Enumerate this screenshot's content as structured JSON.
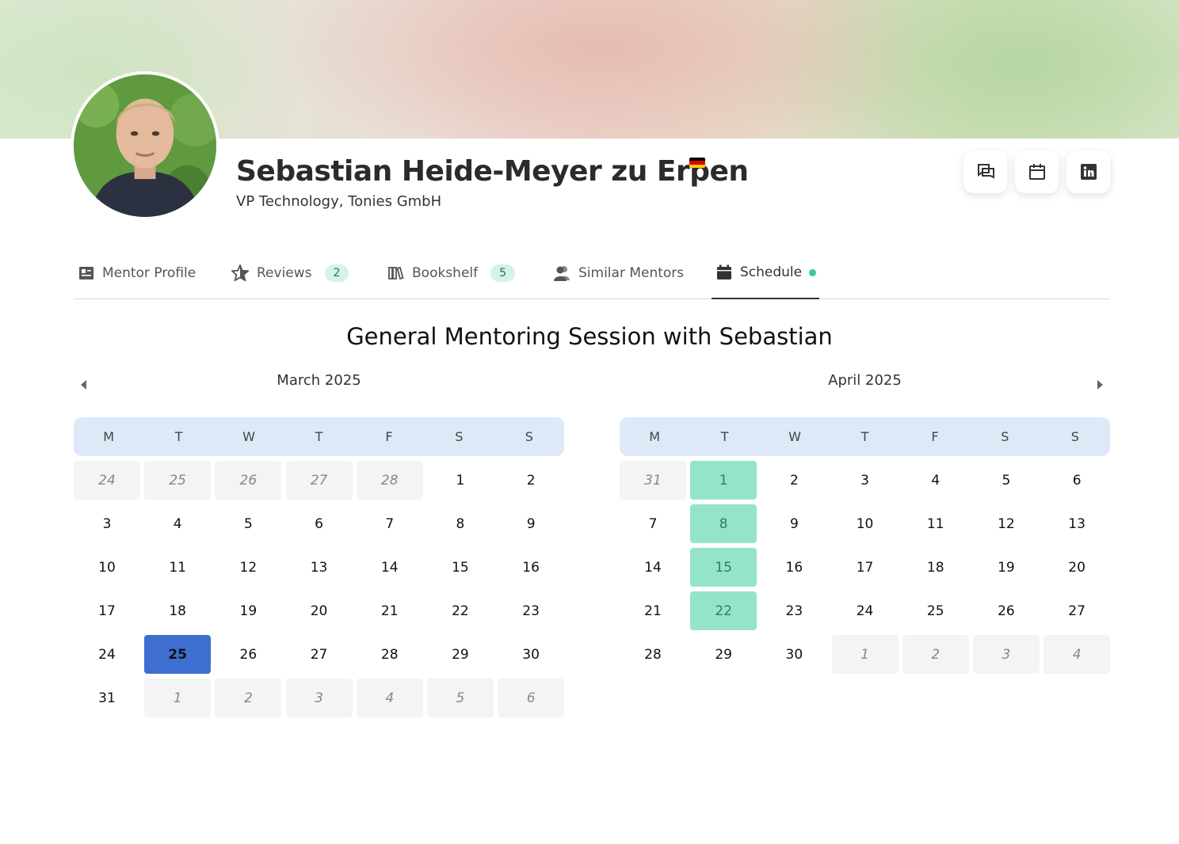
{
  "profile": {
    "name": "Sebastian Heide-Meyer zu Erpen",
    "subtitle": "VP Technology, Tonies GmbH",
    "flag_colors": [
      "#000000",
      "#dd0000",
      "#ffce00"
    ]
  },
  "actions": [
    {
      "icon": "chat-icon"
    },
    {
      "icon": "calendar-icon"
    },
    {
      "icon": "linkedin-icon"
    }
  ],
  "tabs": [
    {
      "label": "Mentor Profile",
      "icon": "profile-card-icon"
    },
    {
      "label": "Reviews",
      "icon": "star-icon",
      "badge": "2"
    },
    {
      "label": "Bookshelf",
      "icon": "books-icon",
      "badge": "5"
    },
    {
      "label": "Similar Mentors",
      "icon": "people-icon"
    },
    {
      "label": "Schedule",
      "icon": "calendar-icon",
      "active": true
    }
  ],
  "session_title": "General Mentoring Session with Sebastian",
  "calendars": [
    {
      "title": "March 2025",
      "weekdays": [
        "M",
        "T",
        "W",
        "T",
        "F",
        "S",
        "S"
      ],
      "days": [
        {
          "d": "24",
          "s": "out"
        },
        {
          "d": "25",
          "s": "out"
        },
        {
          "d": "26",
          "s": "out"
        },
        {
          "d": "27",
          "s": "out"
        },
        {
          "d": "28",
          "s": "out"
        },
        {
          "d": "1",
          "s": ""
        },
        {
          "d": "2",
          "s": ""
        },
        {
          "d": "3",
          "s": ""
        },
        {
          "d": "4",
          "s": ""
        },
        {
          "d": "5",
          "s": ""
        },
        {
          "d": "6",
          "s": ""
        },
        {
          "d": "7",
          "s": ""
        },
        {
          "d": "8",
          "s": ""
        },
        {
          "d": "9",
          "s": ""
        },
        {
          "d": "10",
          "s": ""
        },
        {
          "d": "11",
          "s": ""
        },
        {
          "d": "12",
          "s": ""
        },
        {
          "d": "13",
          "s": ""
        },
        {
          "d": "14",
          "s": ""
        },
        {
          "d": "15",
          "s": ""
        },
        {
          "d": "16",
          "s": ""
        },
        {
          "d": "17",
          "s": ""
        },
        {
          "d": "18",
          "s": ""
        },
        {
          "d": "19",
          "s": ""
        },
        {
          "d": "20",
          "s": ""
        },
        {
          "d": "21",
          "s": ""
        },
        {
          "d": "22",
          "s": ""
        },
        {
          "d": "23",
          "s": ""
        },
        {
          "d": "24",
          "s": ""
        },
        {
          "d": "25",
          "s": "today"
        },
        {
          "d": "26",
          "s": ""
        },
        {
          "d": "27",
          "s": ""
        },
        {
          "d": "28",
          "s": ""
        },
        {
          "d": "29",
          "s": ""
        },
        {
          "d": "30",
          "s": ""
        },
        {
          "d": "31",
          "s": ""
        },
        {
          "d": "1",
          "s": "out"
        },
        {
          "d": "2",
          "s": "out"
        },
        {
          "d": "3",
          "s": "out"
        },
        {
          "d": "4",
          "s": "out"
        },
        {
          "d": "5",
          "s": "out"
        },
        {
          "d": "6",
          "s": "out"
        }
      ]
    },
    {
      "title": "April 2025",
      "weekdays": [
        "M",
        "T",
        "W",
        "T",
        "F",
        "S",
        "S"
      ],
      "days": [
        {
          "d": "31",
          "s": "out"
        },
        {
          "d": "1",
          "s": "avail"
        },
        {
          "d": "2",
          "s": ""
        },
        {
          "d": "3",
          "s": ""
        },
        {
          "d": "4",
          "s": ""
        },
        {
          "d": "5",
          "s": ""
        },
        {
          "d": "6",
          "s": ""
        },
        {
          "d": "7",
          "s": ""
        },
        {
          "d": "8",
          "s": "avail"
        },
        {
          "d": "9",
          "s": ""
        },
        {
          "d": "10",
          "s": ""
        },
        {
          "d": "11",
          "s": ""
        },
        {
          "d": "12",
          "s": ""
        },
        {
          "d": "13",
          "s": ""
        },
        {
          "d": "14",
          "s": ""
        },
        {
          "d": "15",
          "s": "avail"
        },
        {
          "d": "16",
          "s": ""
        },
        {
          "d": "17",
          "s": ""
        },
        {
          "d": "18",
          "s": ""
        },
        {
          "d": "19",
          "s": ""
        },
        {
          "d": "20",
          "s": ""
        },
        {
          "d": "21",
          "s": ""
        },
        {
          "d": "22",
          "s": "avail"
        },
        {
          "d": "23",
          "s": ""
        },
        {
          "d": "24",
          "s": ""
        },
        {
          "d": "25",
          "s": ""
        },
        {
          "d": "26",
          "s": ""
        },
        {
          "d": "27",
          "s": ""
        },
        {
          "d": "28",
          "s": ""
        },
        {
          "d": "29",
          "s": ""
        },
        {
          "d": "30",
          "s": ""
        },
        {
          "d": "1",
          "s": "out"
        },
        {
          "d": "2",
          "s": "out"
        },
        {
          "d": "3",
          "s": "out"
        },
        {
          "d": "4",
          "s": "out"
        }
      ]
    }
  ],
  "colors": {
    "today": "#3e6fd0",
    "available": "#94e4c9",
    "weekday_header": "#dde9f7",
    "badge": "#d3f3e8",
    "schedule_dot": "#3fc7a1"
  }
}
